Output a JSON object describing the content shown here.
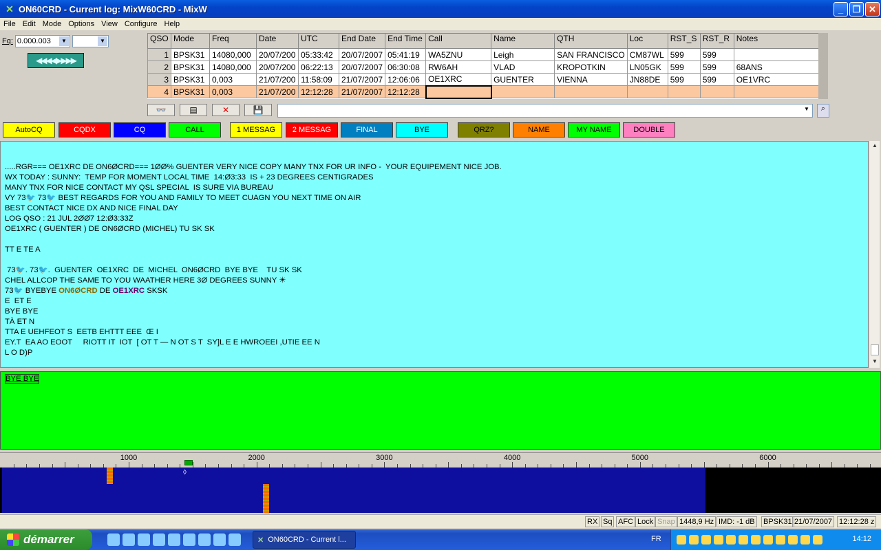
{
  "window": {
    "title": "ON60CRD - Current log: MixW60CRD - MixW",
    "buttons": [
      "_",
      "❐",
      "✕"
    ]
  },
  "menu": [
    "File",
    "Edit",
    "Mode",
    "Options",
    "View",
    "Configure",
    "Help"
  ],
  "freq": {
    "label": "Fq:",
    "value": "0.000.003",
    "second": ""
  },
  "arrows": "◀◀◀◀▶▶▶▶",
  "log": {
    "headers": [
      "QSO",
      "Mode",
      "Freq",
      "Date",
      "UTC",
      "End Date",
      "End Time",
      "Call",
      "Name",
      "QTH",
      "Loc",
      "RST_S",
      "RST_R",
      "Notes"
    ],
    "rows": [
      [
        "1",
        "BPSK31",
        "14080,000",
        "20/07/200",
        "05:33:42",
        "20/07/2007",
        "05:41:19",
        "WA5ZNU",
        "Leigh",
        "SAN FRANCISCO",
        "CM87WL",
        "599",
        "599",
        ""
      ],
      [
        "2",
        "BPSK31",
        "14080,000",
        "20/07/200",
        "06:22:13",
        "20/07/2007",
        "06:30:08",
        "RW6AH",
        "VLAD",
        "KROPOTKIN",
        "LN05GK",
        "599",
        "599",
        "68ANS"
      ],
      [
        "3",
        "BPSK31",
        "0,003",
        "21/07/200",
        "11:58:09",
        "21/07/2007",
        "12:06:06",
        "OE1XRC",
        "GUENTER",
        "VIENNA",
        "JN88DE",
        "599",
        "599",
        "OE1VRC"
      ],
      [
        "4",
        "BPSK31",
        "0,003",
        "21/07/200",
        "12:12:28",
        "21/07/2007",
        "12:12:28",
        "",
        "",
        "",
        "",
        "",
        "",
        ""
      ]
    ]
  },
  "tools": [
    "👓",
    "▤",
    "✕",
    "💾"
  ],
  "macros": [
    {
      "label": "AutoCQ",
      "color": "#ffff00"
    },
    {
      "label": "CQDX",
      "color": "#ff0000"
    },
    {
      "label": "CQ",
      "color": "#0000ff"
    },
    {
      "label": "CALL",
      "color": "#00ff00"
    },
    {
      "label": "1 MESSAG",
      "color": "#ffff00"
    },
    {
      "label": "2 MESSAG",
      "color": "#ff0000"
    },
    {
      "label": "FINAL",
      "color": "#0080c0"
    },
    {
      "label": "BYE",
      "color": "#00ffff"
    },
    {
      "label": "QRZ?",
      "color": "#808000"
    },
    {
      "label": "NAME",
      "color": "#ff8000"
    },
    {
      "label": "MY NAME",
      "color": "#00ff00"
    },
    {
      "label": "DOUBLE",
      "color": "#ff80c0"
    }
  ],
  "rx_lines": [
    ".....RGR=== OE1XRC DE ON6ØCRD=== 1ØØ% GUENTER VERY NICE COPY MANY TNX FOR UR INFO -  YOUR EQUIPEMENT NICE JOB.",
    "WX TODAY : SUNNY:  TEMP FOR MOMENT LOCAL TIME  14:Ø3:33  IS + 23 DEGREES CENTIGRADES",
    "MANY TNX FOR NICE CONTACT MY QSL SPECIAL  IS SURE VIA BUREAU",
    "VY 73🐦 73🐦 BEST REGARDS FOR YOU AND FAMILY TO MEET CUAGN YOU NEXT TIME ON AIR",
    "BEST CONTACT NICE DX AND NICE FINAL DAY",
    "LOG QSO : 21 JUL 2ØØ7 12:Ø3:33Z",
    "OE1XRC ( GUENTER ) DE ON6ØCRD (MICHEL) TU SK SK",
    "",
    "TT E TE A",
    "",
    " 73🐦. 73🐦.  GUENTER  OE1XRC  DE  MICHEL  ON6ØCRD  BYE BYE    TU SK SK",
    "CHEL ALLCOP THE SAME TO YOU WAATHER HERE 3Ø DEGREES SUNNY ☀",
    "73🐦 BYEBYE ON6ØCRD DE OE1XRC SKSK",
    "E  ET E",
    "BYE BYE",
    "TÀ ET N",
    "TTA E UEHFEOT S  EETB EHTTT EEE  Œ I",
    "EY.T  EA AO EOOT     RIOTT IT  IOT  [ OT T — N OT S T  SY]L E E HWROEEI ,UTIE EE N",
    "L O D)P"
  ],
  "tx_text": "BYE BYE",
  "ruler_labels": [
    "1000",
    "2000",
    "3000",
    "4000",
    "5000",
    "6000"
  ],
  "signals_hz": [
    850,
    2070
  ],
  "status": {
    "rx": "RX",
    "sq": "Sq",
    "afc": "AFC",
    "lock": "Lock",
    "snap": "Snap",
    "freq": "1448,9 Hz",
    "imd": "IMD: -1 dB",
    "mode": "BPSK31",
    "date": "21/07/2007",
    "time": "12:12:28 z"
  },
  "taskbar": {
    "start": "démarrer",
    "task": "ON60CRD - Current l...",
    "lang": "FR",
    "clock": "14:12"
  }
}
